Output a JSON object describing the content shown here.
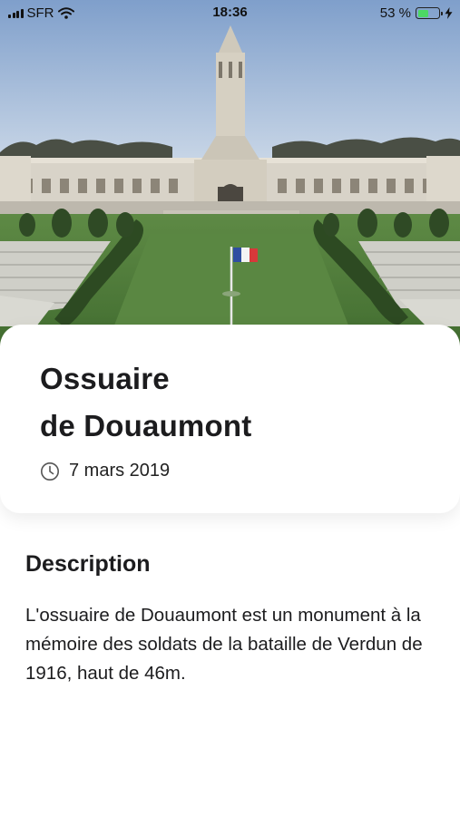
{
  "status_bar": {
    "carrier": "SFR",
    "time": "18:36",
    "battery_percent": "53 %",
    "battery_level": 0.53
  },
  "monument": {
    "title_line1": "Ossuaire",
    "title_line2": "de Douaumont",
    "date": "7 mars 2019"
  },
  "description": {
    "heading": "Description",
    "text": "L'ossuaire de Douaumont est un monument à la mémoire des soldats de la bataille de Verdun de 1916, haut de 46m."
  },
  "icons": {
    "wifi": "wifi-icon",
    "battery": "battery-icon",
    "charging": "bolt-icon",
    "clock": "clock-icon"
  },
  "colors": {
    "battery_fill": "#4cd964",
    "sky": "#8fb2d9",
    "grass": "#4f7a3a"
  }
}
